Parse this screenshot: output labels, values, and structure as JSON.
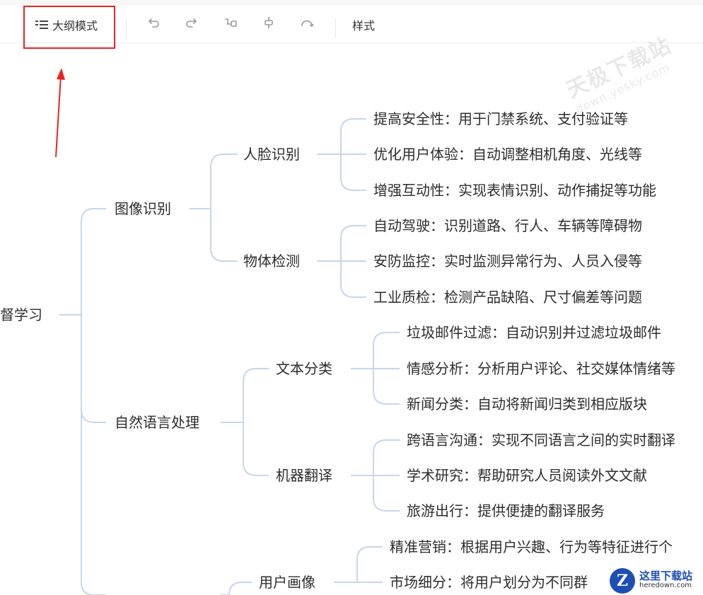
{
  "toolbar": {
    "outline_label": "大纲模式",
    "style_label": "样式",
    "icons": [
      "undo-icon",
      "redo-icon",
      "insert-child-icon",
      "insert-sibling-icon",
      "relation-icon"
    ]
  },
  "watermark": {
    "text": "天极下载站",
    "url": "down.yesky.com"
  },
  "corner_logo": {
    "text": "这里下载站",
    "url": "heredown.com"
  },
  "mindmap": {
    "root": "督学习",
    "branches": [
      {
        "label": "图像识别",
        "children": [
          {
            "label": "人脸识别",
            "children": [
              "提高安全性：用于门禁系统、支付验证等",
              "优化用户体验：自动调整相机角度、光线等",
              "增强互动性：实现表情识别、动作捕捉等功能"
            ]
          },
          {
            "label": "物体检测",
            "children": [
              "自动驾驶：识别道路、行人、车辆等障碍物",
              "安防监控：实时监测异常行为、人员入侵等",
              "工业质检：检测产品缺陷、尺寸偏差等问题"
            ]
          }
        ]
      },
      {
        "label": "自然语言处理",
        "children": [
          {
            "label": "文本分类",
            "children": [
              "垃圾邮件过滤：自动识别并过滤垃圾邮件",
              "情感分析：分析用户评论、社交媒体情绪等",
              "新闻分类：自动将新闻归类到相应版块"
            ]
          },
          {
            "label": "机器翻译",
            "children": [
              "跨语言沟通：实现不同语言之间的实时翻译",
              "学术研究：帮助研究人员阅读外文文献",
              "旅游出行：提供便捷的翻译服务"
            ]
          }
        ]
      },
      {
        "label": "",
        "children": [
          {
            "label": "用户画像",
            "children": [
              "精准营销：根据用户兴趣、行为等特征进行个",
              "市场细分：将用户划分为不同群"
            ]
          }
        ]
      }
    ]
  }
}
